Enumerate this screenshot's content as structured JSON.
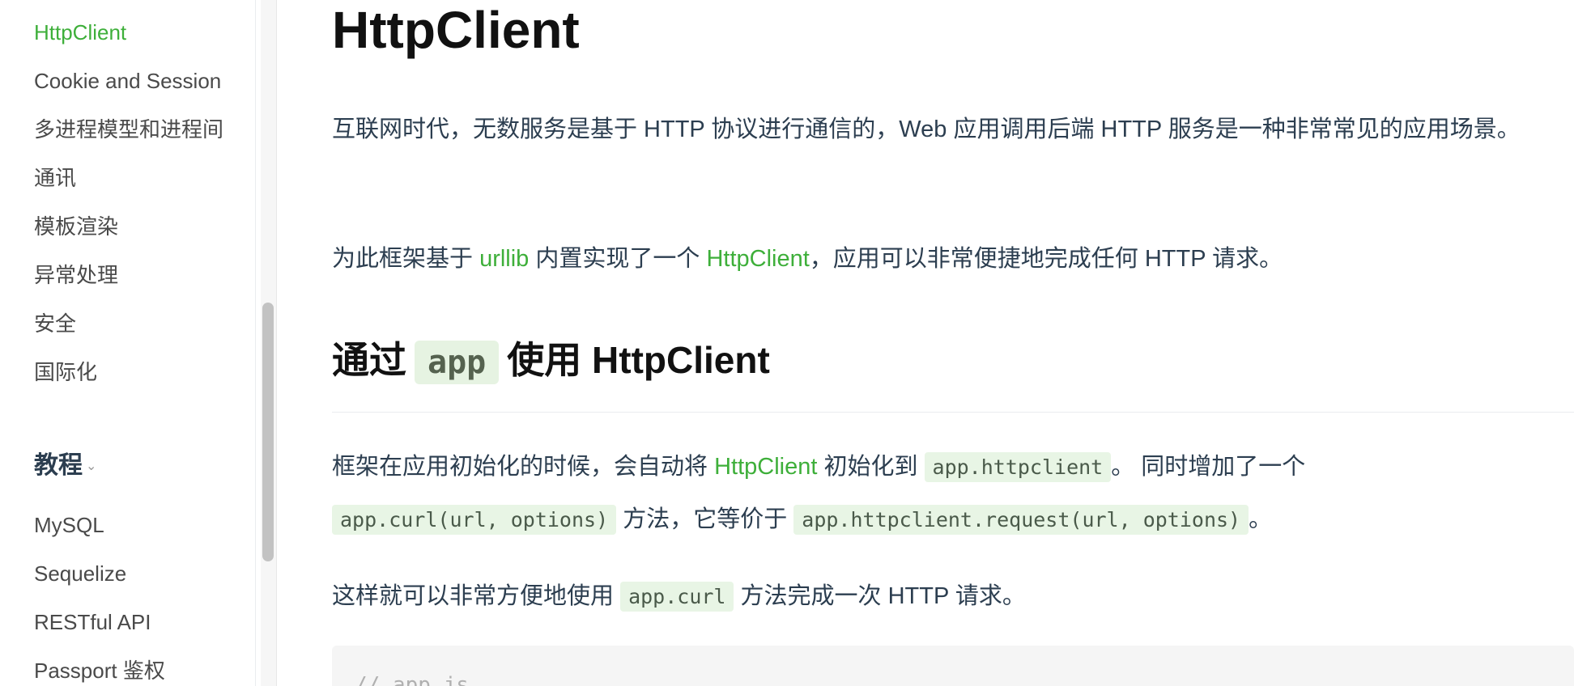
{
  "sidebar": {
    "items": [
      {
        "label": "HttpClient",
        "active": true
      },
      {
        "label": "Cookie and Session"
      },
      {
        "label": "多进程模型和进程间"
      },
      {
        "label": "通讯"
      },
      {
        "label": "模板渲染"
      },
      {
        "label": "异常处理"
      },
      {
        "label": "安全"
      },
      {
        "label": "国际化"
      }
    ],
    "group": {
      "label": "教程",
      "icon": "chevron-down-icon"
    },
    "group_items": [
      {
        "label": "MySQL"
      },
      {
        "label": "Sequelize"
      },
      {
        "label": "RESTful API"
      },
      {
        "label": "Passport 鉴权"
      }
    ]
  },
  "main": {
    "title": "HttpClient",
    "p1": "互联网时代，无数服务是基于 HTTP 协议进行通信的，Web 应用调用后端 HTTP 服务是一种非常常见的应用场景。",
    "p2": {
      "t1": "为此框架基于 ",
      "link1": "urllib",
      "t2": " 内置实现了一个 ",
      "link2": "HttpClient",
      "t3": "，应用可以非常便捷地完成任何 HTTP 请求。"
    },
    "h2": {
      "t1": "通过",
      "code": "app",
      "t2": "使用 HttpClient"
    },
    "p3": {
      "t1": "框架在应用初始化的时候，会自动将 ",
      "link": "HttpClient",
      "t2": " 初始化到 ",
      "code1": "app.httpclient",
      "t3": "。 同时增加了一个",
      "code2": "app.curl(url, options)",
      "t4": " 方法，它等价于 ",
      "code3": "app.httpclient.request(url, options)",
      "t5": "。"
    },
    "p4": {
      "t1": "这样就可以非常方便地使用 ",
      "code": "app.curl",
      "t2": " 方法完成一次 HTTP 请求。"
    },
    "code_comment": "// app.js"
  },
  "colors": {
    "accent": "#3eaf3a",
    "code_bg": "#e8f5e5"
  }
}
